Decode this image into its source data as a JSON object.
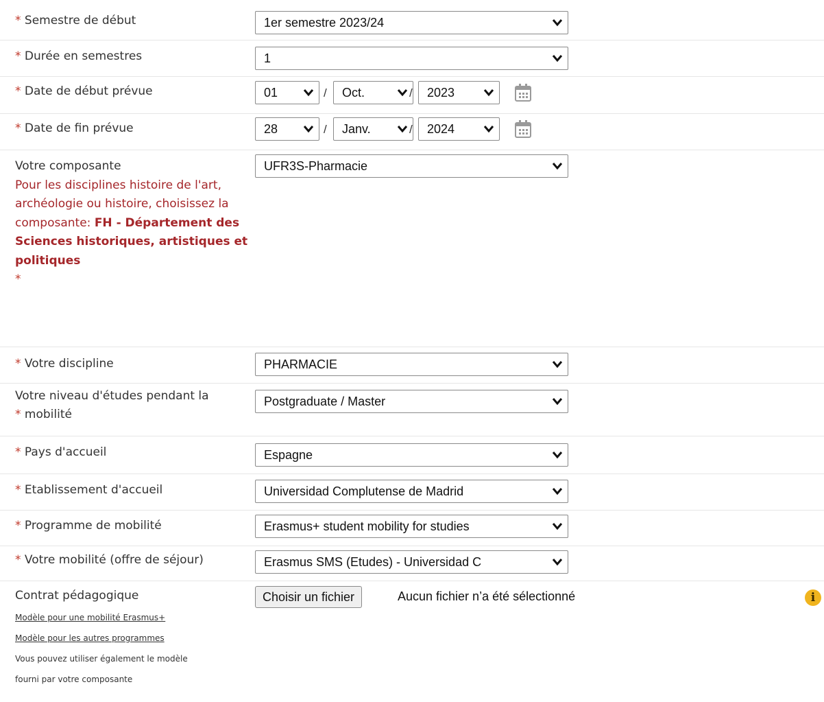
{
  "required_mark": "*",
  "fields": {
    "semestre_debut": {
      "label": "Semestre de début",
      "value": "1er semestre 2023/24"
    },
    "duree": {
      "label": "Durée en semestres",
      "value": "1"
    },
    "date_debut": {
      "label": "Date de début prévue",
      "day": "01",
      "month": "Oct.",
      "year": "2023"
    },
    "date_fin": {
      "label": "Date de fin prévue",
      "day": "28",
      "month": "Janv.",
      "year": "2024"
    },
    "composante": {
      "label": "Votre composante",
      "note": "Pour les disciplines histoire de l'art, archéologie ou histoire, choisissez la composante:",
      "note_bold": "FH - Département des Sciences historiques, artistiques et politiques",
      "value": "UFR3S-Pharmacie"
    },
    "discipline": {
      "label": "Votre discipline",
      "value": "PHARMACIE"
    },
    "niveau": {
      "label": "Votre niveau d'études pendant la",
      "label2": "mobilité",
      "value": "Postgraduate / Master"
    },
    "pays": {
      "label": "Pays d'accueil",
      "value": "Espagne"
    },
    "etablissement": {
      "label": "Etablissement d'accueil",
      "value": "Universidad Complutense de Madrid"
    },
    "programme": {
      "label": "Programme de mobilité",
      "value": "Erasmus+ student mobility for studies"
    },
    "mobilite": {
      "label": "Votre mobilité (offre de séjour)",
      "value": "Erasmus SMS (Etudes) - Universidad C"
    },
    "contrat": {
      "label": "Contrat pédagogique",
      "button": "Choisir un fichier",
      "status": "Aucun fichier n’a été sélectionné",
      "link1": "Modèle pour une mobilité Erasmus+",
      "link2": "Modèle pour les autres programmes",
      "hint_line1": "Vous pouvez utiliser également le modèle",
      "hint_line2": "fourni par votre composante",
      "info_glyph": "i"
    }
  },
  "date_separator": "/",
  "icons": {
    "select_arrow": "chevron-down-icon",
    "calendar": "calendar-icon",
    "info": "info-icon"
  },
  "colors": {
    "required": "#c0392b",
    "note": "#a5262a",
    "info_badge": "#f0b41e"
  }
}
